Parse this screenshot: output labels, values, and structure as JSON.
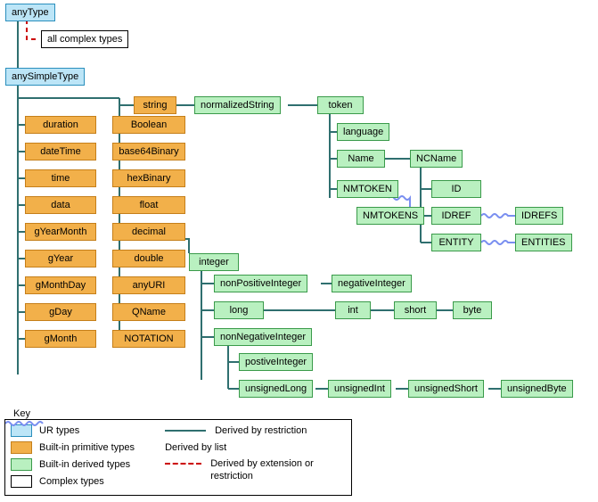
{
  "nodes": {
    "anyType": "anyType",
    "allComplex": "all complex types",
    "anySimpleType": "anySimpleType",
    "string": "string",
    "normalizedString": "normalizedString",
    "token": "token",
    "language": "language",
    "Name": "Name",
    "NCName": "NCName",
    "NMTOKEN": "NMTOKEN",
    "NMTOKENS": "NMTOKENS",
    "ID": "ID",
    "IDREF": "IDREF",
    "IDREFS": "IDREFS",
    "ENTITY": "ENTITY",
    "ENTITIES": "ENTITIES",
    "duration": "duration",
    "dateTime": "dateTime",
    "time": "time",
    "data": "data",
    "gYearMonth": "gYearMonth",
    "gYear": "gYear",
    "gMonthDay": "gMonthDay",
    "gDay": "gDay",
    "gMonth": "gMonth",
    "Boolean": "Boolean",
    "base64Binary": "base64Binary",
    "hexBinary": "hexBinary",
    "float": "float",
    "decimal": "decimal",
    "double": "double",
    "anyURI": "anyURI",
    "QName": "QName",
    "NOTATION": "NOTATION",
    "integer": "integer",
    "nonPositiveInteger": "nonPositiveInteger",
    "negativeInteger": "negativeInteger",
    "long": "long",
    "int": "int",
    "short": "short",
    "byte": "byte",
    "nonNegativeInteger": "nonNegativeInteger",
    "positiveInteger": "postiveInteger",
    "unsignedLong": "unsignedLong",
    "unsignedInt": "unsignedInt",
    "unsignedShort": "unsignedShort",
    "unsignedByte": "unsignedByte"
  },
  "legend": {
    "title": "Key",
    "ur": "UR types",
    "prim": "Built-in primitive types",
    "deriv": "Built-in derived types",
    "complex": "Complex types",
    "restriction": "Derived by restriction",
    "list": "Derived by list",
    "extOrRest": "Derived by extension or restriction"
  }
}
